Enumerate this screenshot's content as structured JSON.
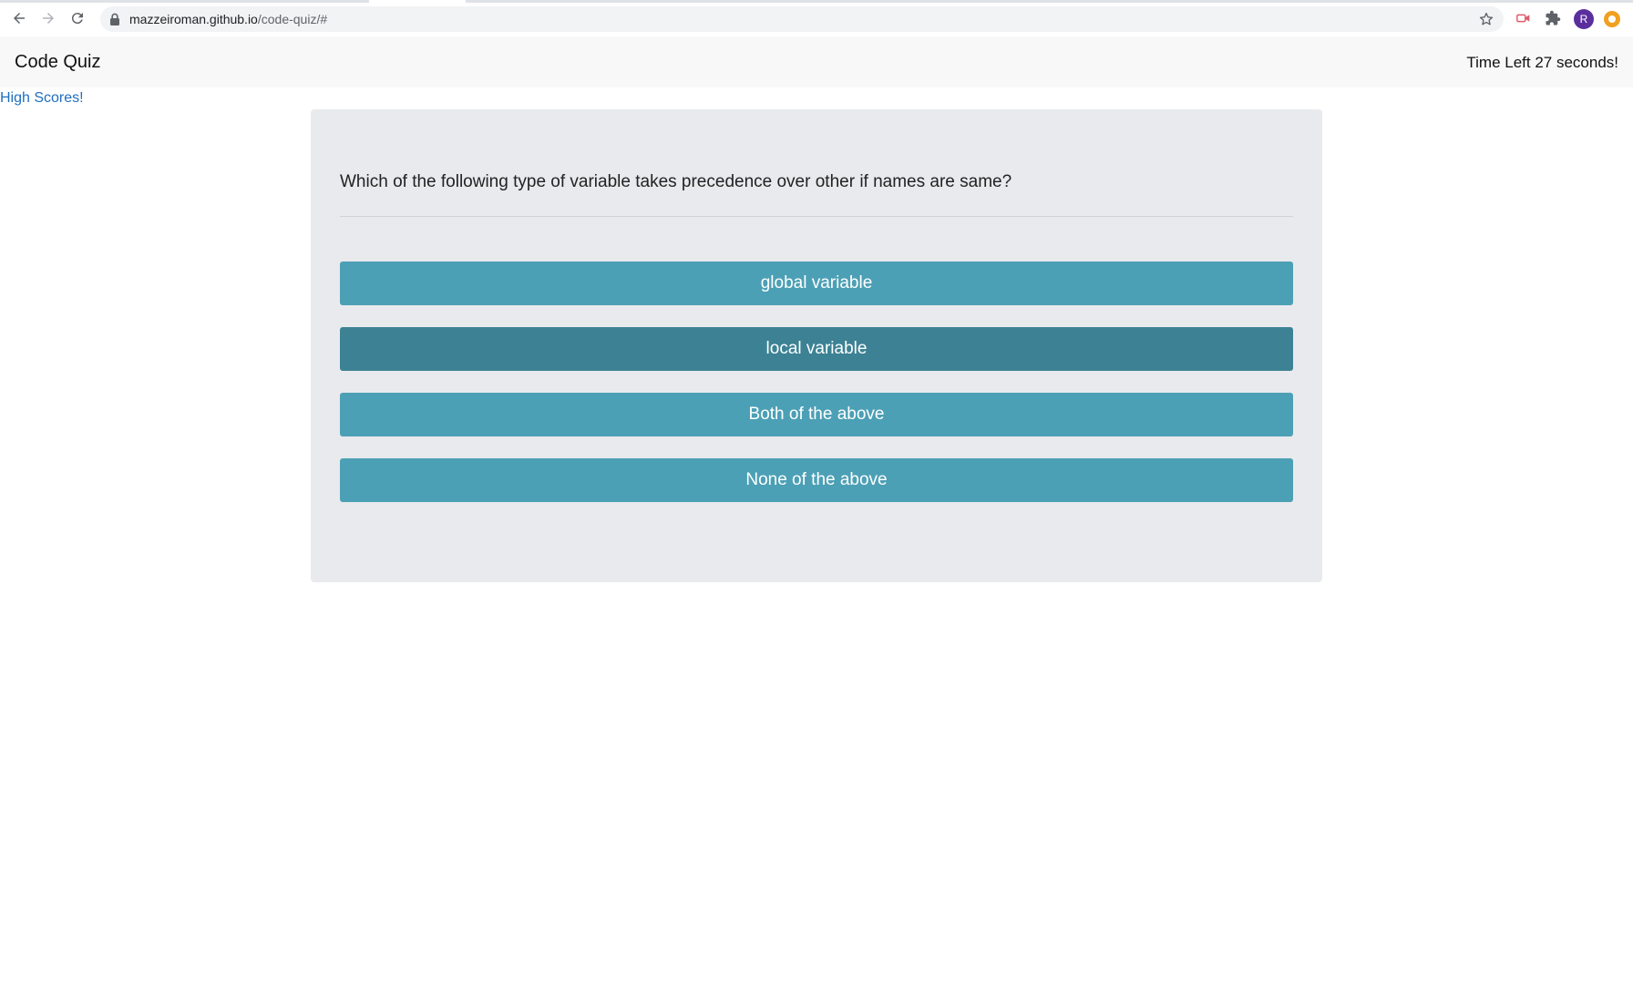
{
  "browser": {
    "url_host": "mazzeiroman.github.io",
    "url_path": "/code-quiz/#",
    "profile_initial": "R"
  },
  "header": {
    "title": "Code Quiz",
    "timer_text": "Time Left 27 seconds!"
  },
  "links": {
    "high_scores": "High Scores!"
  },
  "quiz": {
    "question": "Which of the following type of variable takes precedence over other if names are same?",
    "answers": [
      {
        "label": "global variable",
        "hovered": false
      },
      {
        "label": "local variable",
        "hovered": true
      },
      {
        "label": "Both of the above",
        "hovered": false
      },
      {
        "label": "None of the above",
        "hovered": false
      }
    ]
  },
  "colors": {
    "answer_bg": "#4ca0b5",
    "answer_hover_bg": "#3c8294",
    "card_bg": "#e9eaed",
    "link": "#1f6fbf"
  }
}
